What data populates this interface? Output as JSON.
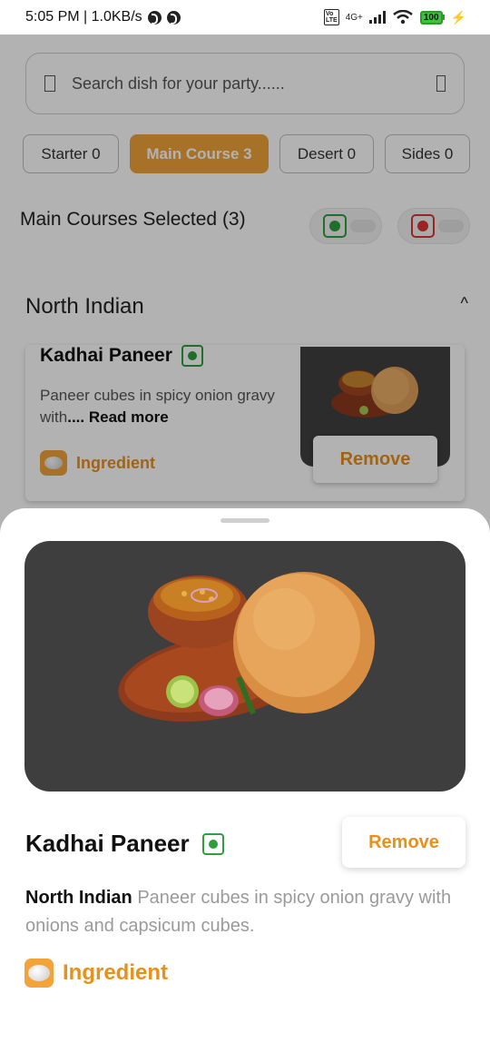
{
  "status_bar": {
    "time_speed": "5:05 PM | 1.0KB/s",
    "network": "4G+",
    "battery": "100"
  },
  "search": {
    "placeholder": "Search dish for your party......"
  },
  "tabs": [
    {
      "label": "Starter 0",
      "active": false
    },
    {
      "label": "Main Course 3",
      "active": true
    },
    {
      "label": "Desert 0",
      "active": false
    },
    {
      "label": "Sides 0",
      "active": false
    }
  ],
  "selected_label": "Main Courses Selected (3)",
  "filters": {
    "veg": "veg-toggle",
    "nonveg": "nonveg-toggle"
  },
  "section": {
    "title": "North Indian",
    "chevron": "^"
  },
  "card": {
    "name": "Kadhai Paneer",
    "desc": "Paneer cubes in spicy onion gravy with",
    "read_more": ".... Read more",
    "ingredient": "Ingredient",
    "remove": "Remove"
  },
  "sheet": {
    "name": "Kadhai Paneer",
    "remove": "Remove",
    "cuisine": "North Indian",
    "description": " Paneer cubes in spicy onion gravy with onions and capsicum cubes.",
    "ingredient": "Ingredient"
  },
  "colors": {
    "accent": "#f0a43a",
    "veg": "#2e9e3e",
    "nonveg": "#d33333"
  }
}
